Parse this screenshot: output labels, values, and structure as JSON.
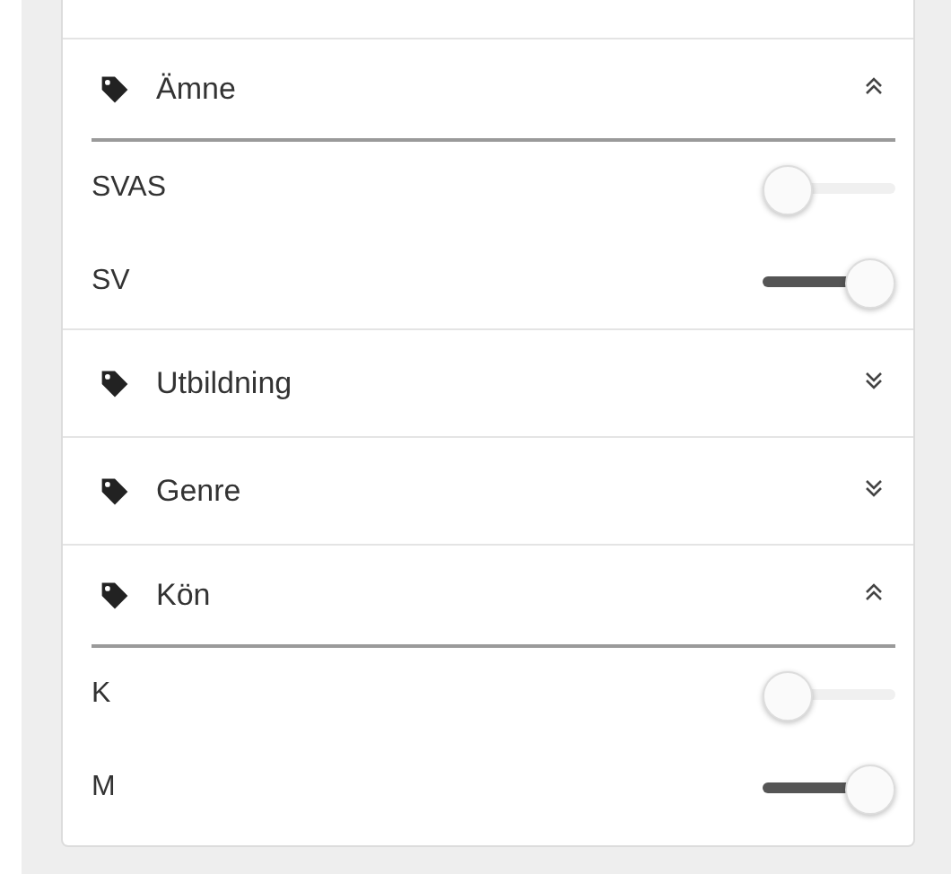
{
  "sections": [
    {
      "title": "Ämne",
      "expanded": true,
      "options": [
        {
          "label": "SVAS",
          "on": false
        },
        {
          "label": "SV",
          "on": true
        }
      ]
    },
    {
      "title": "Utbildning",
      "expanded": false
    },
    {
      "title": "Genre",
      "expanded": false
    },
    {
      "title": "Kön",
      "expanded": true,
      "options": [
        {
          "label": "K",
          "on": false
        },
        {
          "label": "M",
          "on": true
        }
      ]
    }
  ]
}
